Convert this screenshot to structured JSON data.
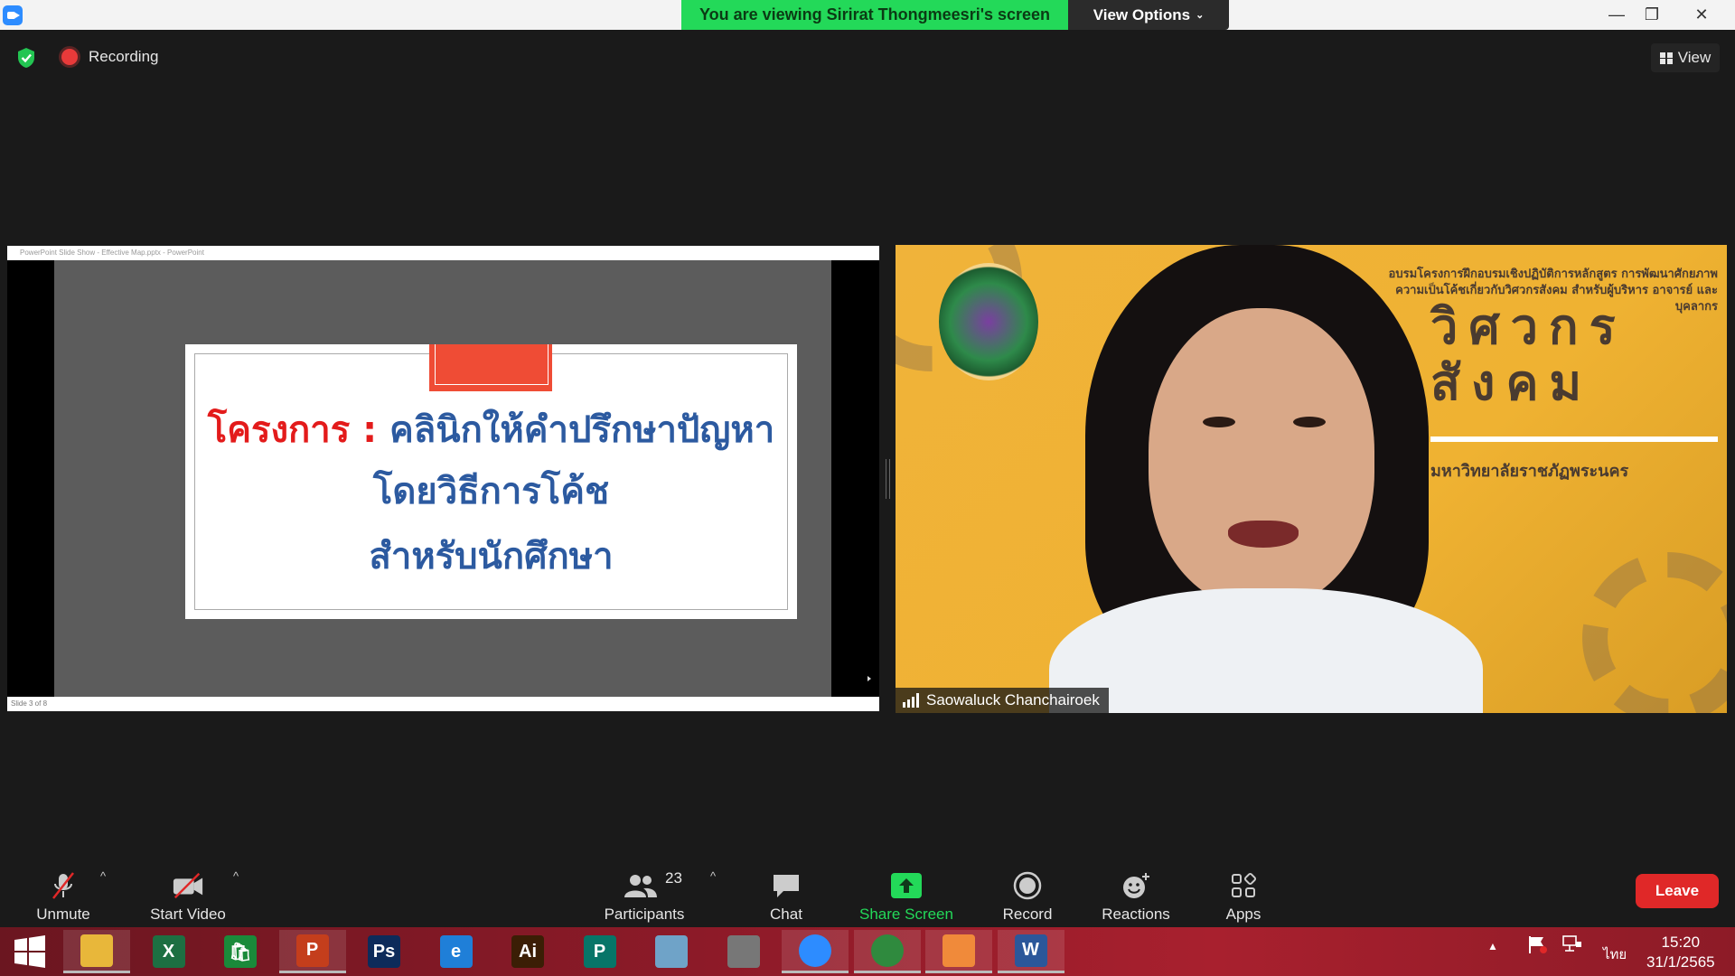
{
  "titlebar": {
    "viewing_banner": "You are viewing Sirirat Thongmeesri's screen",
    "view_options": "View Options",
    "minimize": "—",
    "restore": "❐",
    "close": "✕"
  },
  "meeting": {
    "recording_label": "Recording",
    "view_label": "View"
  },
  "shared_screen": {
    "ppt_title": "PowerPoint Slide Show - Effective Map.pptx - PowerPoint",
    "slide_status": "Slide 3 of 8",
    "slide": {
      "line1_prefix": "โครงการ :",
      "line1_rest": " คลินิกให้คำปรึกษาปัญหา",
      "line2": "โดยวิธีการโค้ช",
      "line3": "สำหรับนักศึกษา"
    }
  },
  "participant_video": {
    "name": "Saowaluck Chanchairoek",
    "banner_text": "อบรมโครงการฝึกอบรมเชิงปฏิบัติการหลักสูตร การพัฒนาศักยภาพความเป็นโค้ชเกี่ยวกับวิศวกรสังคม สำหรับผู้บริหาร อาจารย์ และบุคลากร",
    "big_title_1": "วิศวกร",
    "big_title_2": "สังคม",
    "university": "มหาวิทยาลัยราชภัฏพระนคร"
  },
  "toolbar": {
    "unmute": "Unmute",
    "start_video": "Start Video",
    "participants": "Participants",
    "participant_count": "23",
    "chat": "Chat",
    "share_screen": "Share Screen",
    "record": "Record",
    "reactions": "Reactions",
    "apps": "Apps",
    "leave": "Leave",
    "caret": "^"
  },
  "taskbar": {
    "apps": [
      {
        "name": "file-explorer",
        "glyph": "",
        "color": "#e8b73a"
      },
      {
        "name": "excel",
        "glyph": "X",
        "color": "#1d6f42"
      },
      {
        "name": "store",
        "glyph": "🛍",
        "color": "#1a8a3a"
      },
      {
        "name": "powerpoint",
        "glyph": "P",
        "color": "#c43e1c"
      },
      {
        "name": "photoshop",
        "glyph": "Ps",
        "color": "#0d2b5a"
      },
      {
        "name": "internet-explorer",
        "glyph": "e",
        "color": "#1f7fd8"
      },
      {
        "name": "illustrator",
        "glyph": "Ai",
        "color": "#3b1e05"
      },
      {
        "name": "publisher",
        "glyph": "P",
        "color": "#077568"
      },
      {
        "name": "notes",
        "glyph": "",
        "color": "#6fa3c8"
      },
      {
        "name": "hotocape",
        "glyph": "",
        "color": "#777777"
      },
      {
        "name": "zoom",
        "glyph": "",
        "color": "#2d8cff"
      },
      {
        "name": "chrome",
        "glyph": "",
        "color": "#2f8a3e"
      },
      {
        "name": "paint",
        "glyph": "",
        "color": "#f08a3a"
      },
      {
        "name": "word",
        "glyph": "W",
        "color": "#2b579a"
      }
    ],
    "language": "ไทย",
    "time": "15:20",
    "date": "31/1/2565"
  }
}
